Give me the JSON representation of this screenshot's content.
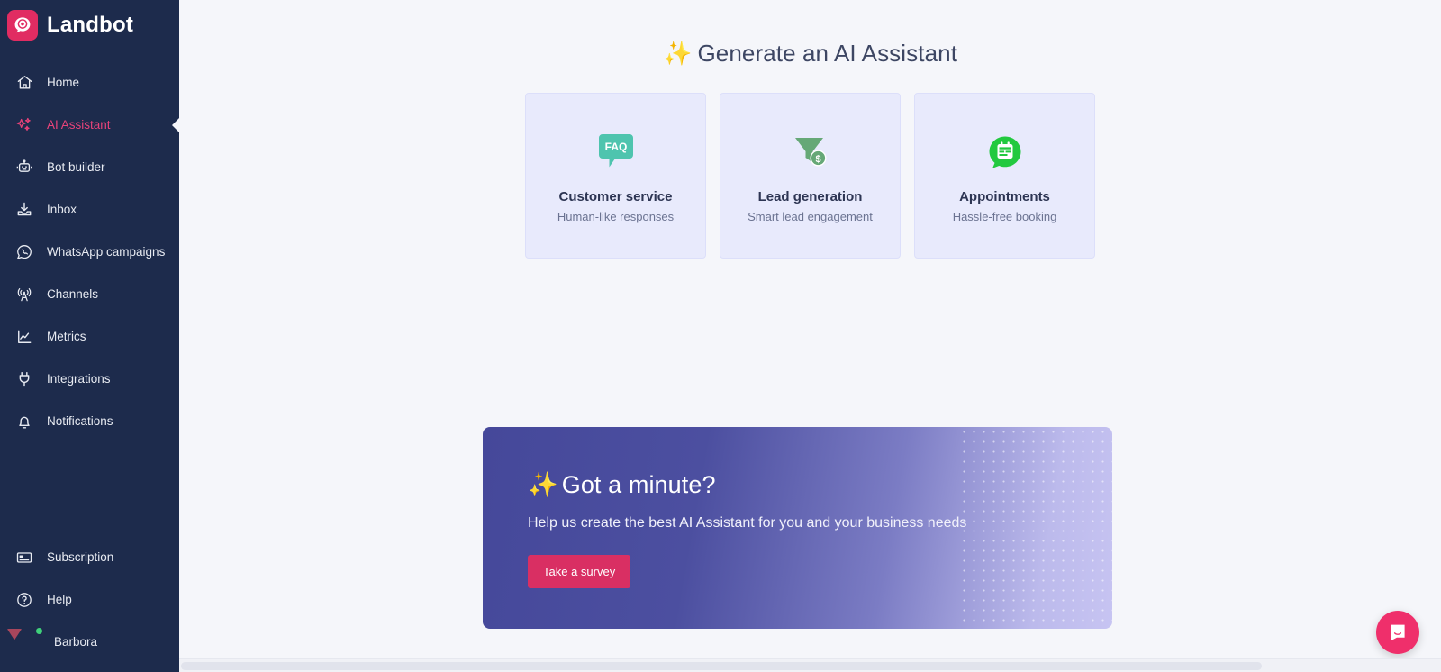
{
  "sidebar": {
    "brand": {
      "name": "Landbot",
      "logo_icon": "landbot-logo-icon"
    },
    "items": [
      {
        "label": "Home",
        "icon": "home-icon",
        "active": false
      },
      {
        "label": "AI Assistant",
        "icon": "sparkles-icon",
        "active": true
      },
      {
        "label": "Bot builder",
        "icon": "robot-icon",
        "active": false
      },
      {
        "label": "Inbox",
        "icon": "inbox-tray-icon",
        "active": false
      },
      {
        "label": "WhatsApp campaigns",
        "icon": "whatsapp-icon",
        "active": false
      },
      {
        "label": "Channels",
        "icon": "broadcast-tower-icon",
        "active": false
      },
      {
        "label": "Metrics",
        "icon": "line-chart-icon",
        "active": false
      },
      {
        "label": "Integrations",
        "icon": "plug-icon",
        "active": false
      },
      {
        "label": "Notifications",
        "icon": "bell-icon",
        "active": false
      }
    ],
    "bottom_items": [
      {
        "label": "Subscription",
        "icon": "credit-card-icon"
      },
      {
        "label": "Help",
        "icon": "question-circle-icon"
      }
    ],
    "user": {
      "name": "Barbora",
      "status": "online",
      "avatar_icon": "user-avatar"
    },
    "colors": {
      "background": "#1d2b4c",
      "active_text": "#e8437a",
      "text": "#e8ebf2"
    }
  },
  "main": {
    "title": "Generate an AI Assistant",
    "title_emoji": "✨",
    "cards": [
      {
        "title": "Customer service",
        "subtitle": "Human-like responses",
        "icon": "faq-speech-bubble-icon",
        "icon_label": "FAQ",
        "icon_color": "#4ec4ae"
      },
      {
        "title": "Lead generation",
        "subtitle": "Smart lead engagement",
        "icon": "funnel-dollar-icon",
        "icon_label": "",
        "icon_color": "#66a877"
      },
      {
        "title": "Appointments",
        "subtitle": "Hassle-free booking",
        "icon": "calendar-bubble-icon",
        "icon_label": "",
        "icon_color": "#22c93f"
      }
    ],
    "banner": {
      "title": "Got a minute?",
      "title_emoji": "✨",
      "subtitle": "Help us create the best AI Assistant for you and your business needs",
      "cta_label": "Take a survey",
      "cta_color": "#d92f63",
      "gradient_from": "#45489a",
      "gradient_to": "#c7c4f2"
    },
    "chat_launcher": {
      "icon": "chat-bubble-icon",
      "color": "#ef2f6b"
    },
    "background_color": "#f5f6fa"
  }
}
